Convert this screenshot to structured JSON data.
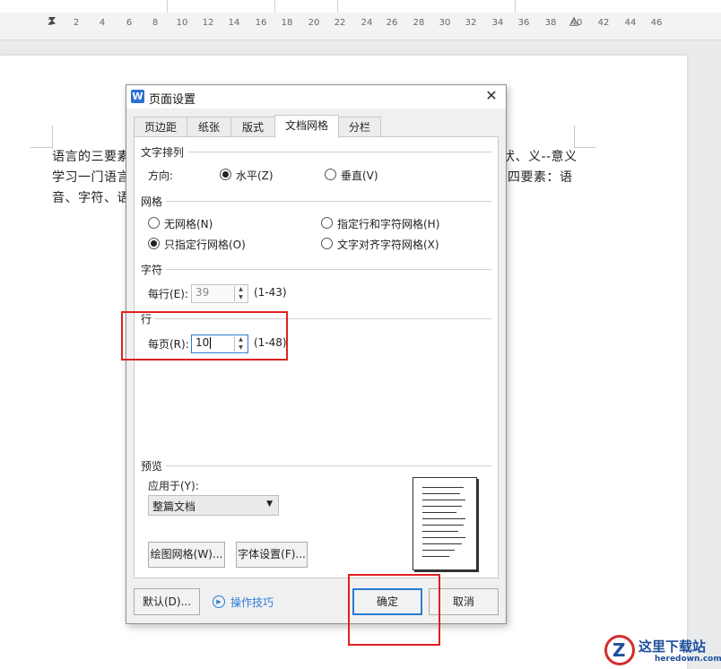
{
  "toolbar": {
    "items": [
      "↓",
      "⌵",
      "┘"
    ]
  },
  "ruler": {
    "ticks": [
      "2",
      "2",
      "4",
      "6",
      "8",
      "10",
      "12",
      "14",
      "16",
      "18",
      "20",
      "22",
      "24",
      "26",
      "28",
      "30",
      "32",
      "34",
      "36",
      "38",
      "40",
      "42",
      "44",
      "46"
    ]
  },
  "document": {
    "line1_left": "语言的三要素",
    "line1_right": "状、义--意义",
    "line2_left": "学习一门语言",
    "line2_right": "四要素：语",
    "line3_left": "音、字符、语"
  },
  "dialog": {
    "icon": "W",
    "title": "页面设置",
    "close": "✕",
    "tabs": [
      "页边距",
      "纸张",
      "版式",
      "文档网格",
      "分栏"
    ],
    "active_tab": "文档网格",
    "text_direction": {
      "group": "文字排列",
      "label": "方向:",
      "horizontal": "水平(Z)",
      "vertical": "垂直(V)",
      "selected": "水平(Z)"
    },
    "grid": {
      "group": "网格",
      "none": "无网格(N)",
      "line_only": "只指定行网格(O)",
      "line_and_char": "指定行和字符网格(H)",
      "align_char": "文字对齐字符网格(X)",
      "selected": "只指定行网格(O)"
    },
    "chars": {
      "group": "字符",
      "label": "每行(E):",
      "value": "39",
      "range": "(1-43)"
    },
    "lines": {
      "group": "行",
      "label": "每页(R):",
      "value": "10",
      "range": "(1-48)"
    },
    "preview": {
      "group": "预览",
      "apply_label": "应用于(Y):",
      "apply_value": "整篇文档"
    },
    "buttons": {
      "draw_grid": "绘图网格(W)...",
      "font_settings": "字体设置(F)...",
      "default": "默认(D)...",
      "tips": "操作技巧",
      "ok": "确定",
      "cancel": "取消"
    }
  },
  "watermark": {
    "brand": "这里下载站",
    "url": "heredown.com"
  },
  "colors": {
    "accent": "#2b6fd6",
    "highlight_red": "#e02020",
    "tips_link": "#2a7cd6"
  }
}
